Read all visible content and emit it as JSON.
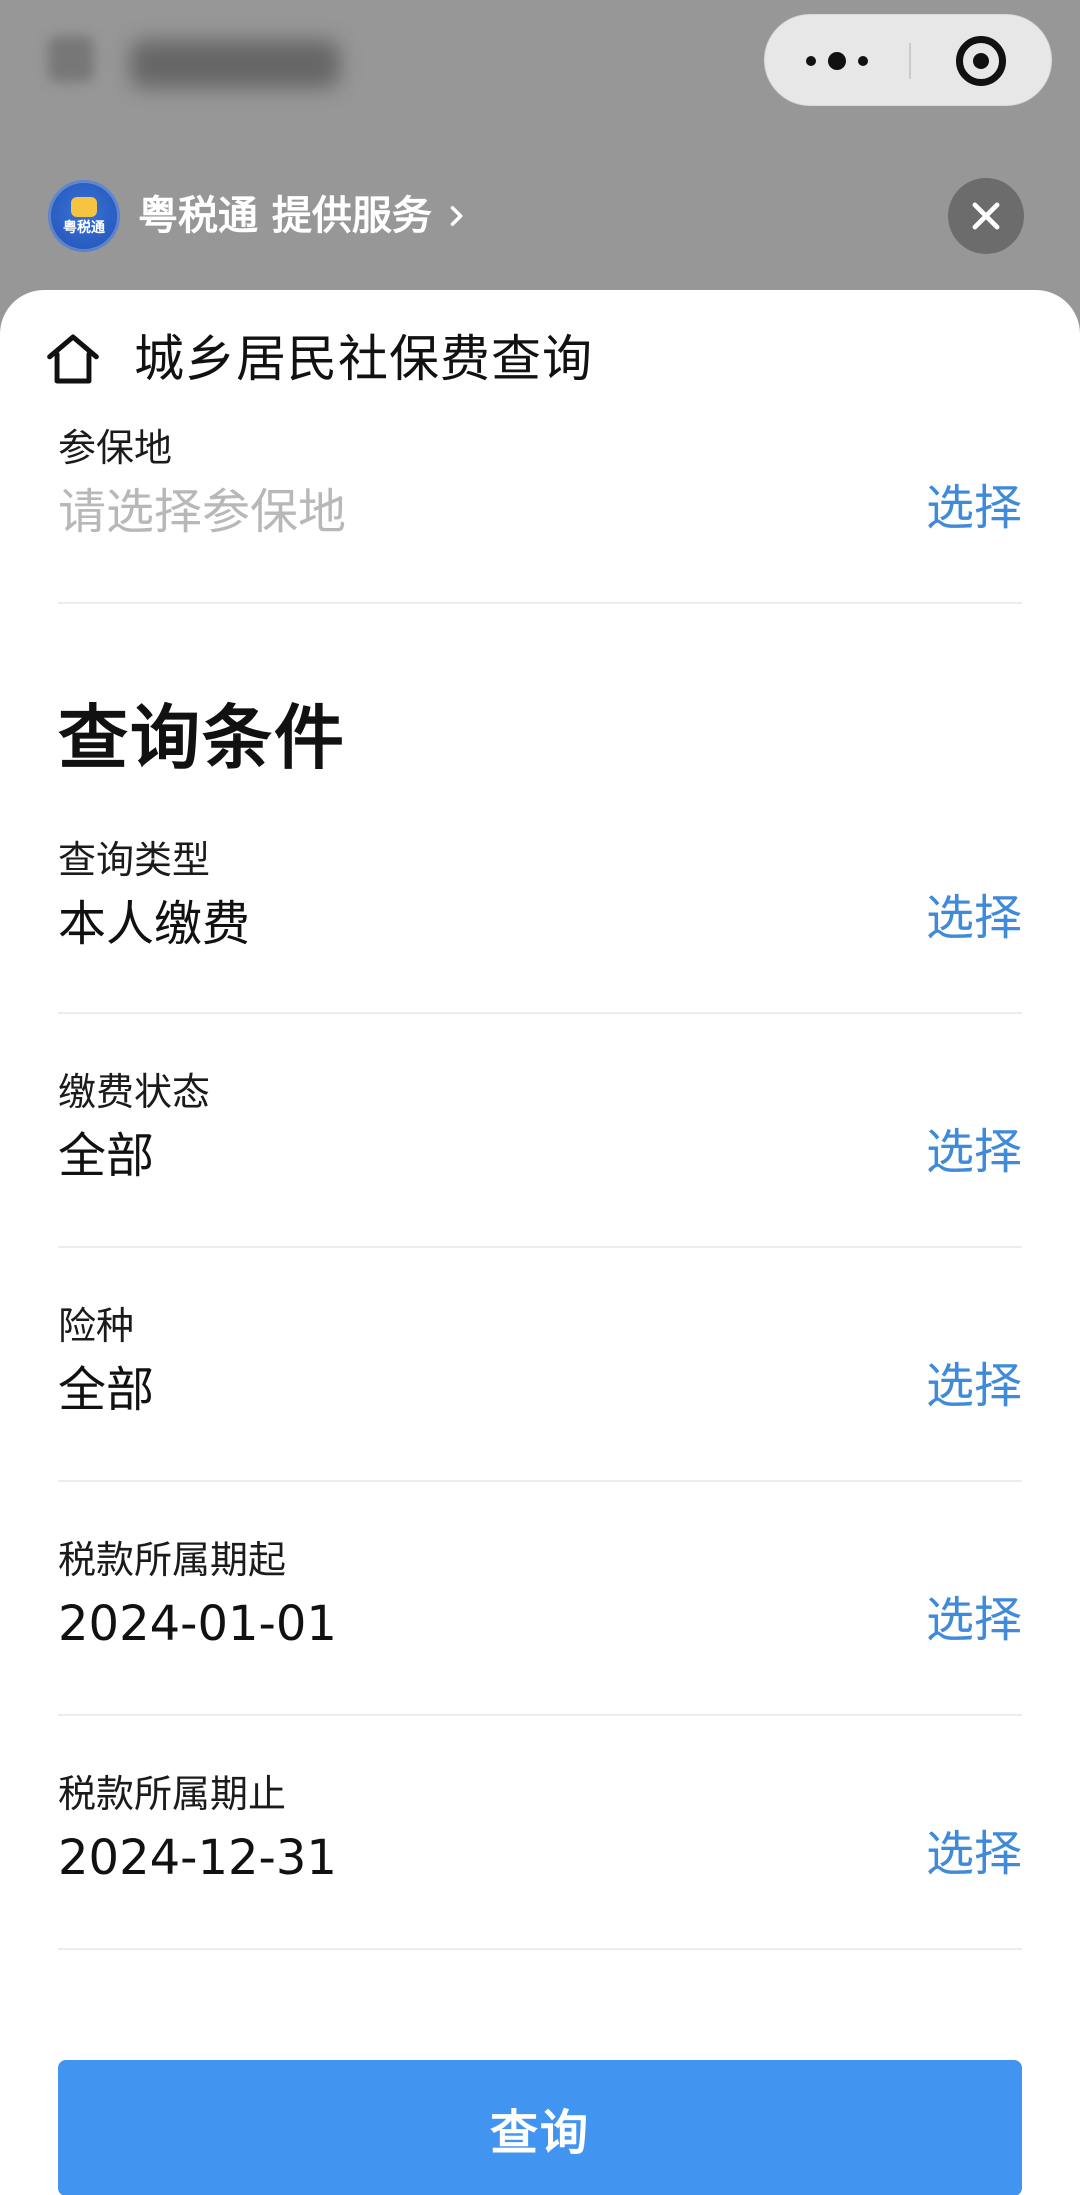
{
  "provider": {
    "name": "粤税通 提供服务",
    "logo_text": "粤税通"
  },
  "page": {
    "title": "城乡居民社保费查询"
  },
  "fields": {
    "insured_place": {
      "label": "参保地",
      "placeholder": "请选择参保地",
      "action": "选择"
    },
    "query_conditions_title": "查询条件",
    "query_type": {
      "label": "查询类型",
      "value": "本人缴费",
      "action": "选择"
    },
    "payment_status": {
      "label": "缴费状态",
      "value": "全部",
      "action": "选择"
    },
    "insurance_type": {
      "label": "险种",
      "value": "全部",
      "action": "选择"
    },
    "tax_period_start": {
      "label": "税款所属期起",
      "value": "2024-01-01",
      "action": "选择"
    },
    "tax_period_end": {
      "label": "税款所属期止",
      "value": "2024-12-31",
      "action": "选择"
    }
  },
  "actions": {
    "query": "查询"
  },
  "colors": {
    "accent_blue": "#4294f1",
    "link_blue": "#3f8ad9",
    "divider": "#ececec",
    "overlay_gray": "#979797"
  },
  "icons": {
    "home": "home-icon",
    "more": "more-icon",
    "target": "target-icon",
    "close": "close-icon",
    "chevron": "chevron-right-icon"
  }
}
